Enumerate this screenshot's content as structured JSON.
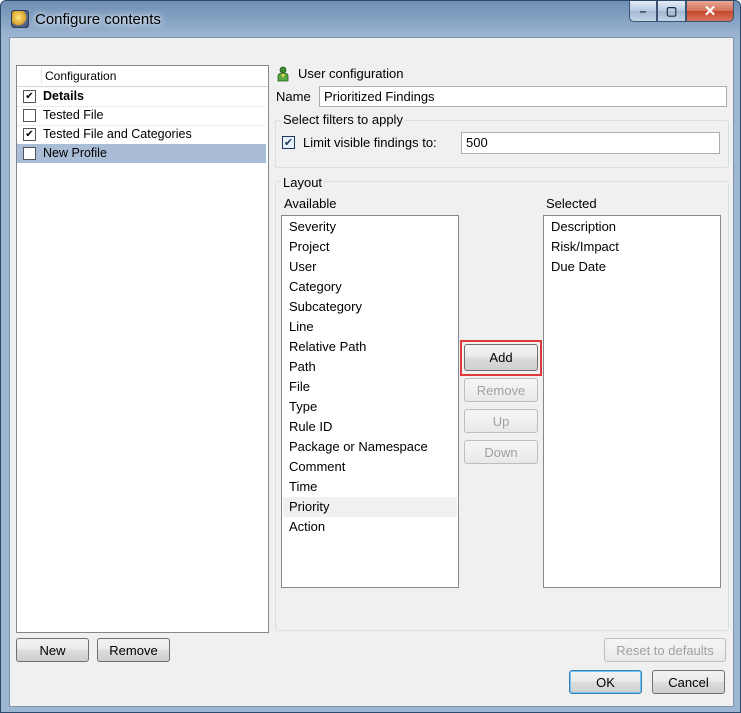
{
  "window": {
    "title": "Configure contents",
    "caption_buttons": {
      "minimize": "–",
      "maximize": "▢",
      "close": "✕"
    }
  },
  "tree": {
    "header": "Configuration",
    "items": [
      {
        "label": "Details",
        "checked": true,
        "bold": true
      },
      {
        "label": "Tested File",
        "checked": false,
        "bold": false
      },
      {
        "label": "Tested File and Categories",
        "checked": true,
        "bold": false
      },
      {
        "label": "New Profile",
        "checked": false,
        "bold": false,
        "selected": true
      }
    ]
  },
  "user_config": {
    "heading": "User configuration",
    "name_label": "Name",
    "name_value": "Prioritized Findings"
  },
  "filters": {
    "group_title": "Select filters to apply",
    "limit_label": "Limit visible findings to:",
    "limit_checked": true,
    "limit_value": "500"
  },
  "layout": {
    "group_title": "Layout",
    "available_label": "Available",
    "selected_label": "Selected",
    "available": [
      "Severity",
      "Project",
      "User",
      "Category",
      "Subcategory",
      "Line",
      "Relative Path",
      "Path",
      "File",
      "Type",
      "Rule ID",
      "Package or Namespace",
      "Comment",
      "Time",
      "Priority",
      "Action"
    ],
    "available_hover": "Priority",
    "selected": [
      "Description",
      "Risk/Impact",
      "Due Date"
    ],
    "buttons": {
      "add": "Add",
      "remove": "Remove",
      "up": "Up",
      "down": "Down"
    }
  },
  "footer": {
    "new": "New",
    "remove": "Remove",
    "reset": "Reset to defaults",
    "ok": "OK",
    "cancel": "Cancel"
  },
  "colors": {
    "highlight": "#e0383a",
    "selection": "#a9bdd6"
  }
}
